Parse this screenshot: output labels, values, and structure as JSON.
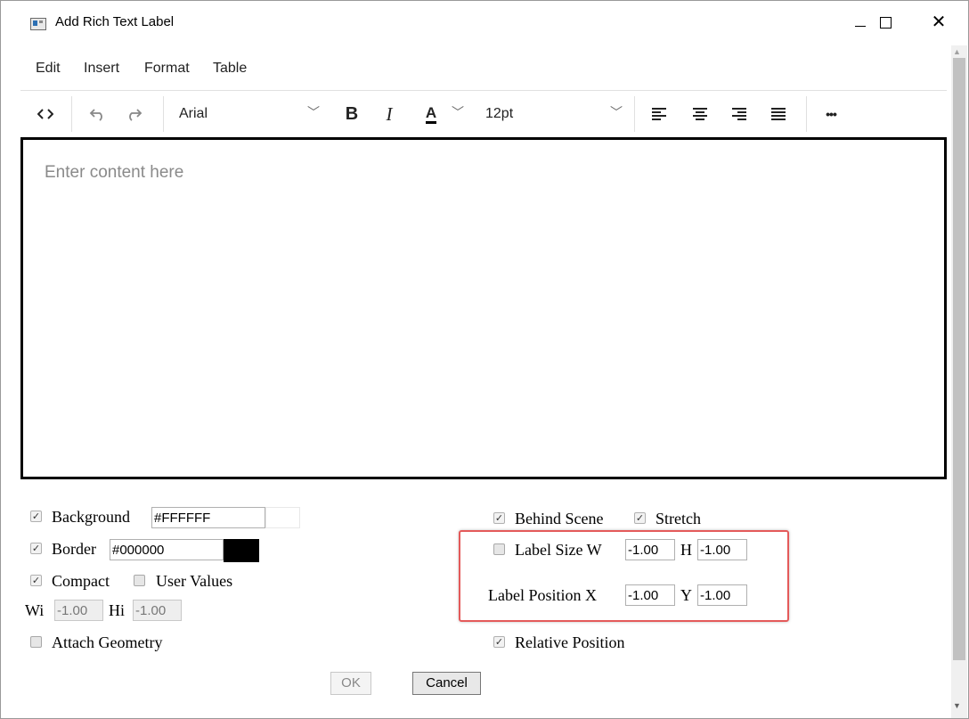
{
  "window": {
    "title": "Add Rich Text Label"
  },
  "menu": [
    "Edit",
    "Insert",
    "Format",
    "Table"
  ],
  "toolbar": {
    "font": "Arial",
    "size": "12pt",
    "bold": "B",
    "italic": "I",
    "font_color": "A",
    "more": "•••"
  },
  "editor": {
    "placeholder": "Enter content here"
  },
  "options": {
    "background_label": "Background",
    "background_value": "#FFFFFF",
    "background_color": "#FFFFFF",
    "border_label": "Border",
    "border_value": "#000000",
    "border_color": "#000000",
    "compact_label": "Compact",
    "user_values_label": "User Values",
    "wi_label": "Wi",
    "wi_value": "-1.00",
    "hi_label": "Hi",
    "hi_value": "-1.00",
    "attach_geometry_label": "Attach Geometry",
    "behind_scene_label": "Behind Scene",
    "stretch_label": "Stretch",
    "label_size_label": "Label Size W",
    "size_w_value": "-1.00",
    "size_h_label": "H",
    "size_h_value": "-1.00",
    "label_position_label": "Label Position X",
    "pos_x_value": "-1.00",
    "pos_y_label": "Y",
    "pos_y_value": "-1.00",
    "relative_position_label": "Relative Position"
  },
  "checks": {
    "background": true,
    "border": true,
    "compact": true,
    "user_values": false,
    "attach_geometry": false,
    "behind_scene": true,
    "stretch": true,
    "label_size": false,
    "relative_position": true
  },
  "buttons": {
    "ok": "OK",
    "cancel": "Cancel"
  },
  "colors": {
    "highlight": "#E45A5A"
  }
}
